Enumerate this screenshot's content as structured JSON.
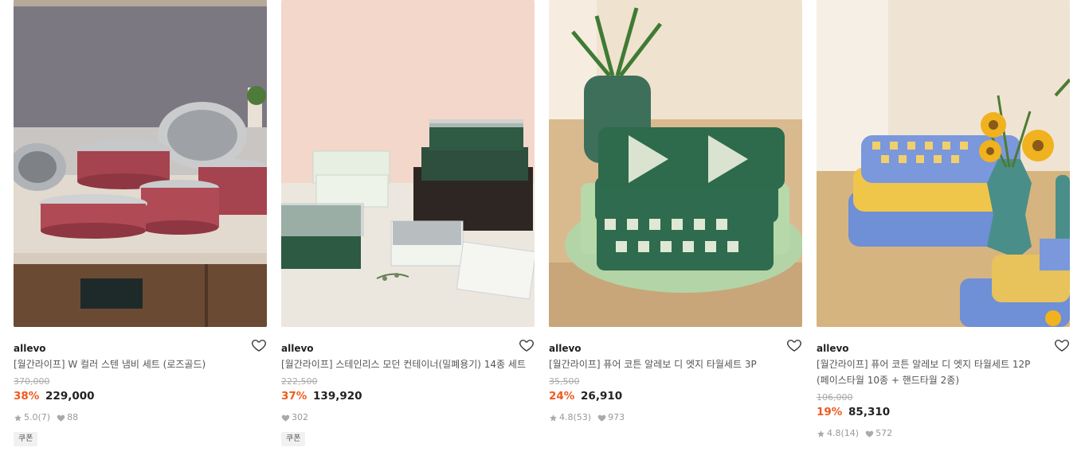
{
  "products": [
    {
      "brand": "allevo",
      "name_lines": [
        "[월간라이프] W 컬러 스텐 냄비 세트 (로즈골드)"
      ],
      "original_price": "370,000",
      "discount": "38%",
      "price": "229,000",
      "rating": "5.0",
      "reviews": "(7)",
      "likes": "88",
      "badge": "쿠폰",
      "image": "cookware-set"
    },
    {
      "brand": "allevo",
      "name_lines": [
        "[월간라이프] 스테인리스 모던 컨테이너(밀폐용기) 14종 세트"
      ],
      "original_price": "222,500",
      "discount": "37%",
      "price": "139,920",
      "likes": "302",
      "badge": "쿠폰",
      "image": "food-containers"
    },
    {
      "brand": "allevo",
      "name_lines": [
        "[월간라이프] 퓨어 코튼 알레보 디 엣지 타월세트 3P"
      ],
      "original_price": "35,500",
      "discount": "24%",
      "price": "26,910",
      "rating": "4.8",
      "reviews": "(53)",
      "likes": "973",
      "image": "green-towels"
    },
    {
      "brand": "allevo",
      "name_lines": [
        "[월간라이프] 퓨어 코튼 알레보 디 엣지 타월세트 12P",
        "(페이스타월 10종 + 핸드타월 2종)"
      ],
      "original_price": "106,000",
      "discount": "19%",
      "price": "85,310",
      "rating": "4.8",
      "reviews": "(14)",
      "likes": "572",
      "image": "blue-yellow-towels"
    }
  ],
  "icons": {
    "like": "heart-outline-icon",
    "star": "star-icon",
    "likes": "heart-filled-icon"
  },
  "colors": {
    "discount": "#ef5a1f",
    "text": "#222222",
    "muted": "#999999"
  }
}
